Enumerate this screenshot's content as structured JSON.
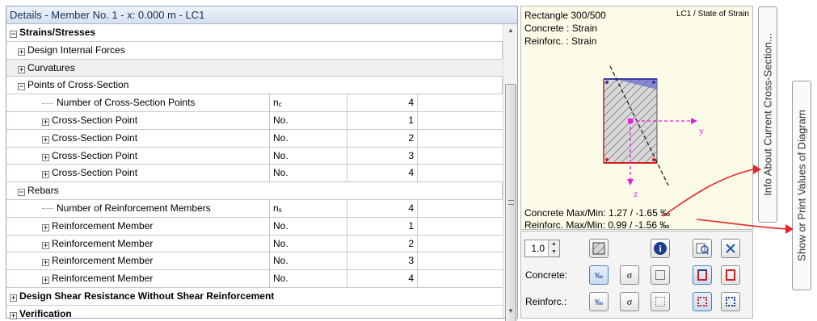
{
  "header": {
    "title": "Details  -  Member No. 1  -  x: 0.000 m  -  LC1"
  },
  "rows": [
    {
      "name": "Strains/Stresses",
      "tog": "⊟",
      "kind": "top"
    },
    {
      "name": "Design Internal Forces",
      "tog": "⊞",
      "kind": "sub"
    },
    {
      "name": "Curvatures",
      "tog": "⊞",
      "kind": "group"
    },
    {
      "name": "Points of Cross-Section",
      "tog": "⊟",
      "kind": "sub"
    },
    {
      "name": "Number of Cross-Section Points",
      "sym": "n",
      "sub": "c",
      "val": "4",
      "kind": "leaf"
    },
    {
      "name": "Cross-Section Point",
      "tog": "⊞",
      "sym": "No.",
      "val": "1",
      "kind": "item"
    },
    {
      "name": "Cross-Section Point",
      "tog": "⊞",
      "sym": "No.",
      "val": "2",
      "kind": "item"
    },
    {
      "name": "Cross-Section Point",
      "tog": "⊞",
      "sym": "No.",
      "val": "3",
      "kind": "item"
    },
    {
      "name": "Cross-Section Point",
      "tog": "⊞",
      "sym": "No.",
      "val": "4",
      "kind": "item"
    },
    {
      "name": "Rebars",
      "tog": "⊟",
      "kind": "sub"
    },
    {
      "name": "Number of Reinforcement Members",
      "sym": "n",
      "sub": "s",
      "val": "4",
      "kind": "leaf"
    },
    {
      "name": "Reinforcement Member",
      "tog": "⊞",
      "sym": "No.",
      "val": "1",
      "kind": "item"
    },
    {
      "name": "Reinforcement Member",
      "tog": "⊞",
      "sym": "No.",
      "val": "2",
      "kind": "item"
    },
    {
      "name": "Reinforcement Member",
      "tog": "⊞",
      "sym": "No.",
      "val": "3",
      "kind": "item"
    },
    {
      "name": "Reinforcement Member",
      "tog": "⊞",
      "sym": "No.",
      "val": "4",
      "kind": "item"
    },
    {
      "name": "Design Shear Resistance Without Shear Reinforcement",
      "tog": "⊞",
      "kind": "top"
    },
    {
      "name": "Verification",
      "tog": "⊞",
      "kind": "top"
    }
  ],
  "graphic": {
    "section": "Rectangle 300/500",
    "case": "LC1 / State of Strain",
    "concrete": "Concrete : Strain",
    "reinforc": "Reinforc. : Strain",
    "axis_y": "y",
    "axis_z": "z",
    "concrete_maxmin": "Concrete   Max/Min:  1.27 / -1.65 ‰",
    "reinforc_maxmin": "Reinforc.   Max/Min:  0.99 / -1.56 ‰"
  },
  "tools": {
    "zoom": "1.0",
    "concrete_label": "Concrete:",
    "reinforc_label": "Reinforc.:",
    "info_glyph": "i",
    "sigma_glyph": "σ",
    "permille_glyph": "‰"
  },
  "callouts": {
    "info": "Info About Current Cross-Section...",
    "print": "Show or Print Values of Diagram"
  },
  "colors": {
    "accent_red": "#e8262a",
    "axis_magenta": "#e020e0",
    "section_fill": "#b9b9b9"
  }
}
